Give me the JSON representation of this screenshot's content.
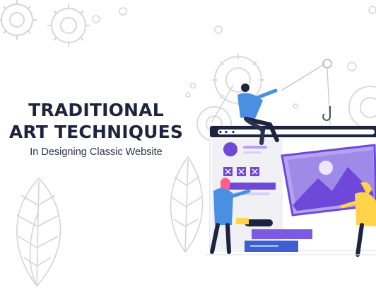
{
  "headline": {
    "line1": "TRADITIONAL",
    "line2": "ART TECHNIQUES",
    "subtitle": "In Designing Classic Website"
  },
  "colors": {
    "navy": "#1e2340",
    "purple": "#6e48d8",
    "lavender": "#b5a2f2",
    "blue": "#4a90e2",
    "yellow": "#ffd44a",
    "pink": "#ff5f8c",
    "gray_outline": "#d6d8de"
  },
  "icons": [
    "gear-icon",
    "leaf-icon",
    "hook-icon",
    "pulley-icon",
    "image-icon",
    "x-box-icon"
  ]
}
